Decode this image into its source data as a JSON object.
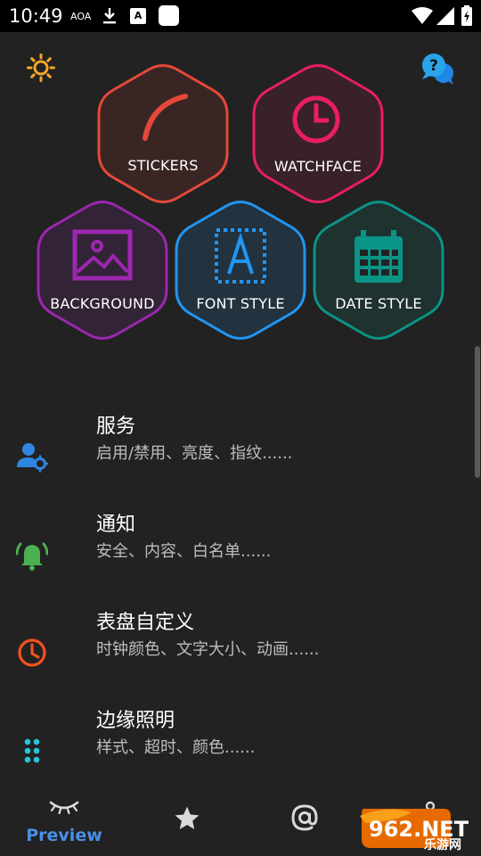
{
  "status_bar": {
    "time": "10:49",
    "aoa": "AOA",
    "a_badge": "A"
  },
  "tiles": [
    {
      "label": "STICKERS",
      "color": "#e5483a"
    },
    {
      "label": "WATCHFACE",
      "color": "#e91e63"
    },
    {
      "label": "BACKGROUND",
      "color": "#9c27b0"
    },
    {
      "label": "FONT STYLE",
      "color": "#2196f3"
    },
    {
      "label": "DATE STYLE",
      "color": "#0a9486"
    }
  ],
  "menu": [
    {
      "title": "服务",
      "subtitle": "启用/禁用、亮度、指纹......",
      "icon": "user-settings-icon",
      "color": "#2f86e0"
    },
    {
      "title": "通知",
      "subtitle": "安全、内容、白名单......",
      "icon": "bell-ringing-icon",
      "color": "#4caf50"
    },
    {
      "title": "表盘自定义",
      "subtitle": "时钟颜色、文字大小、动画......",
      "icon": "clock-icon",
      "color": "#f4511e"
    },
    {
      "title": "边缘照明",
      "subtitle": "样式、超时、颜色......",
      "icon": "dots-grid-icon",
      "color": "#26c6da"
    }
  ],
  "bottom_nav": {
    "preview_label": "Preview",
    "active_color": "#4a8fe7"
  },
  "watermark": {
    "main": "962.NET",
    "sub": "乐游网"
  }
}
